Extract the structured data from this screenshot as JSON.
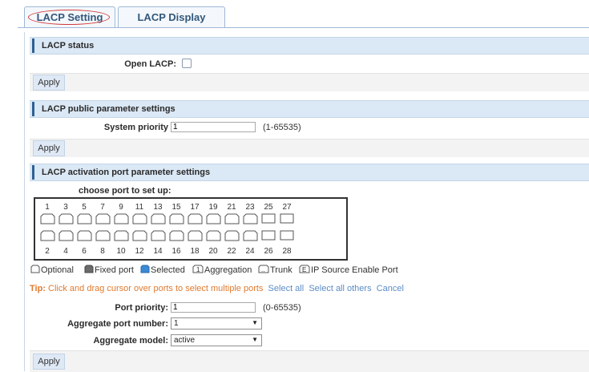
{
  "tabs": {
    "lacp_setting": "LACP Setting",
    "lacp_display": "LACP Display"
  },
  "status_section": {
    "title": "LACP status",
    "open_lacp_label": "Open LACP:",
    "open_lacp_checked": false,
    "apply": "Apply"
  },
  "public_section": {
    "title": "LACP public parameter settings",
    "system_priority_label": "System priority",
    "system_priority_value": "1",
    "system_priority_range": "(1-65535)",
    "apply": "Apply"
  },
  "port_section": {
    "title": "LACP activation port parameter settings",
    "choose_label": "choose port to set up:",
    "top_ports": [
      "1",
      "3",
      "5",
      "7",
      "9",
      "11",
      "13",
      "15",
      "17",
      "19",
      "21",
      "23",
      "25",
      "27"
    ],
    "bottom_ports": [
      "2",
      "4",
      "6",
      "8",
      "10",
      "12",
      "14",
      "16",
      "18",
      "20",
      "22",
      "24",
      "26",
      "28"
    ],
    "legend": [
      "Optional",
      "Fixed port",
      "Selected",
      "Aggregation",
      "Trunk",
      "IP Source Enable Port"
    ],
    "legend_icons": [
      "optional-port-icon",
      "fixed-port-icon",
      "selected-port-icon",
      "aggregation-port-icon",
      "trunk-port-icon",
      "ip-source-port-icon"
    ],
    "tip_key": "Tip:",
    "tip_message": "Click and drag cursor over ports to select multiple ports",
    "select_all": "Select all",
    "select_all_others": "Select all others",
    "cancel": "Cancel",
    "port_priority_label": "Port priority:",
    "port_priority_value": "1",
    "port_priority_range": "(0-65535)",
    "aggregate_port_label": "Aggregate port number:",
    "aggregate_port_value": "1",
    "aggregate_model_label": "Aggregate model:",
    "aggregate_model_value": "active",
    "apply": "Apply"
  }
}
